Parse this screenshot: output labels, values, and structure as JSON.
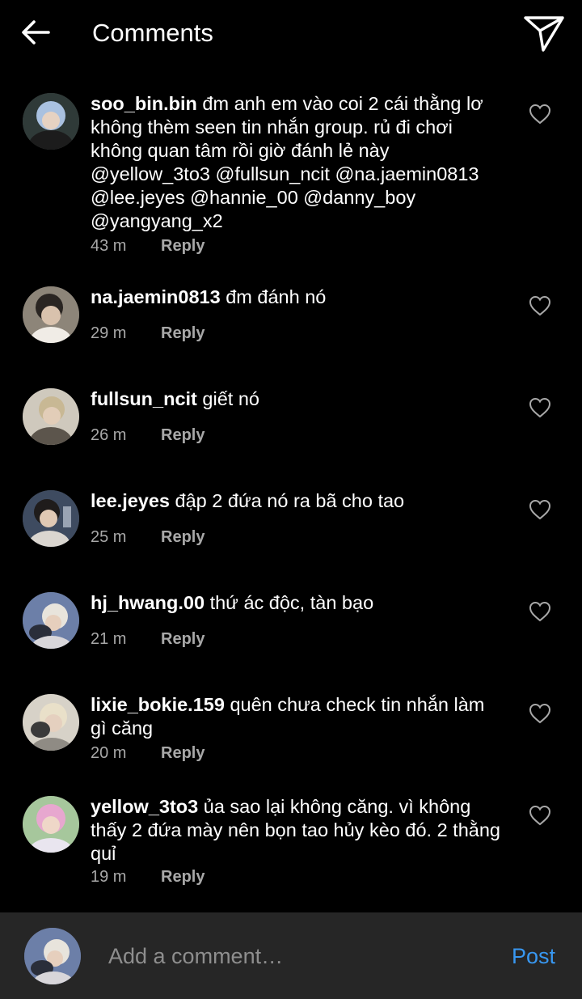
{
  "header": {
    "title": "Comments"
  },
  "comments": [
    {
      "username": "soo_bin.bin",
      "text": "đm anh em vào coi 2 cái thằng lơ không thèm seen tin nhắn group. rủ đi chơi không quan tâm rồi giờ đánh lẻ này @yellow_3to3 @fullsun_ncit @na.jaemin0813 @lee.jeyes @hannie_00 @danny_boy @yangyang_x2",
      "time": "43 m",
      "reply": "Reply",
      "avatar_color": "#8aa6c8"
    },
    {
      "username": "na.jaemin0813",
      "text": "đm đánh nó",
      "time": "29 m",
      "reply": "Reply",
      "avatar_color": "#6b6258"
    },
    {
      "username": "fullsun_ncit",
      "text": "giết nó",
      "time": "26 m",
      "reply": "Reply",
      "avatar_color": "#9a9280"
    },
    {
      "username": "lee.jeyes",
      "text": "đập 2 đứa nó ra bã cho tao",
      "time": "25 m",
      "reply": "Reply",
      "avatar_color": "#5b6b82"
    },
    {
      "username": "hj_hwang.00",
      "text": "thứ ác độc, tàn bạo",
      "time": "21 m",
      "reply": "Reply",
      "avatar_color": "#4a5d86"
    },
    {
      "username": "lixie_bokie.159",
      "text": "quên chưa check tin nhắn làm gì căng",
      "time": "20 m",
      "reply": "Reply",
      "avatar_color": "#b8b0a0"
    },
    {
      "username": "yellow_3to3",
      "text": "ủa sao lại không căng. vì không thấy 2 đứa mày nên bọn tao hủy kèo đó. 2 thằng quỉ",
      "time": "19 m",
      "reply": "Reply",
      "avatar_color": "#b9a6cf"
    }
  ],
  "footer": {
    "placeholder": "Add a comment…",
    "post_label": "Post",
    "post_color": "#3897f0"
  }
}
